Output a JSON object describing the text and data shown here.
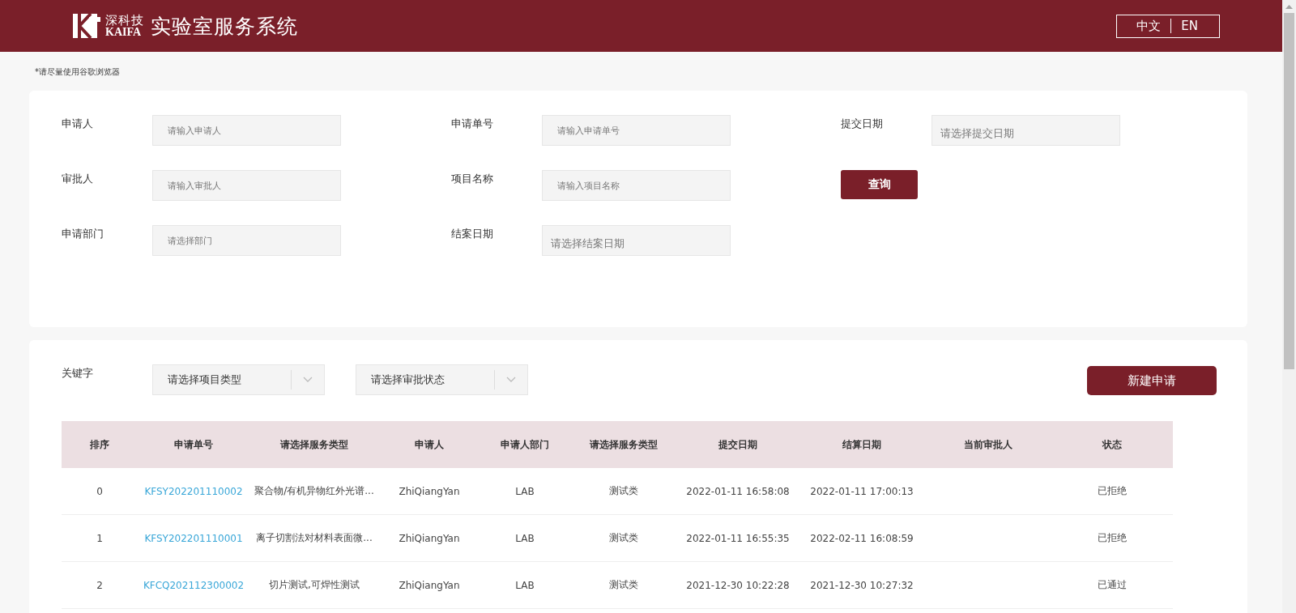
{
  "header": {
    "brand_cn": "深科技",
    "brand_en": "KAIFA",
    "title": "实验室服务系统",
    "languages": [
      "中文",
      "EN"
    ]
  },
  "notice": "*请尽量使用谷歌浏览器",
  "filters": [
    {
      "label": "申请人",
      "placeholder": "请输入申请人",
      "kind": "text"
    },
    {
      "label": "申请单号",
      "placeholder": "请输入申请单号",
      "kind": "text"
    },
    {
      "label": "提交日期",
      "placeholder": "请选择提交日期",
      "kind": "date"
    },
    {
      "label": "审批人",
      "placeholder": "请输入审批人",
      "kind": "text"
    },
    {
      "label": "项目名称",
      "placeholder": "请输入项目名称",
      "kind": "text"
    },
    {
      "kind": "button",
      "label": "查询"
    },
    {
      "label": "申请部门",
      "placeholder": "请选择部门",
      "kind": "text"
    },
    {
      "label": "结案日期",
      "placeholder": "请选择结案日期",
      "kind": "date"
    }
  ],
  "list": {
    "keyword_label": "关键字",
    "selects": [
      {
        "placeholder": "请选择项目类型"
      },
      {
        "placeholder": "请选择审批状态"
      }
    ],
    "new_button": "新建申请"
  },
  "table": {
    "columns": [
      "排序",
      "申请单号",
      "请选择服务类型",
      "申请人",
      "申请人部门",
      "请选择服务类型",
      "提交日期",
      "结算日期",
      "当前审批人",
      "状态"
    ],
    "rows": [
      {
        "index": "0",
        "number": "KFSY202201110002",
        "service": "聚合物/有机异物红外光谱...",
        "applicant": "ZhiQiangYan",
        "department": "LAB",
        "type": "测试类",
        "submitted": "2022-01-11 16:58:08",
        "settled": "2022-01-11 17:00:13",
        "status": "已拒绝"
      },
      {
        "index": "1",
        "number": "KFSY202201110001",
        "service": "离子切割法对材料表面微...",
        "applicant": "ZhiQiangYan",
        "department": "LAB",
        "type": "测试类",
        "submitted": "2022-01-11 16:55:35",
        "settled": "2022-02-11 16:08:59",
        "status": "已拒绝"
      },
      {
        "index": "2",
        "number": "KFCQ202112300002",
        "service": "切片测试,可焊性测试",
        "applicant": "ZhiQiangYan",
        "department": "LAB",
        "type": "测试类",
        "submitted": "2021-12-30 10:22:28",
        "settled": "2021-12-30 10:27:32",
        "status": "已通过"
      }
    ]
  }
}
